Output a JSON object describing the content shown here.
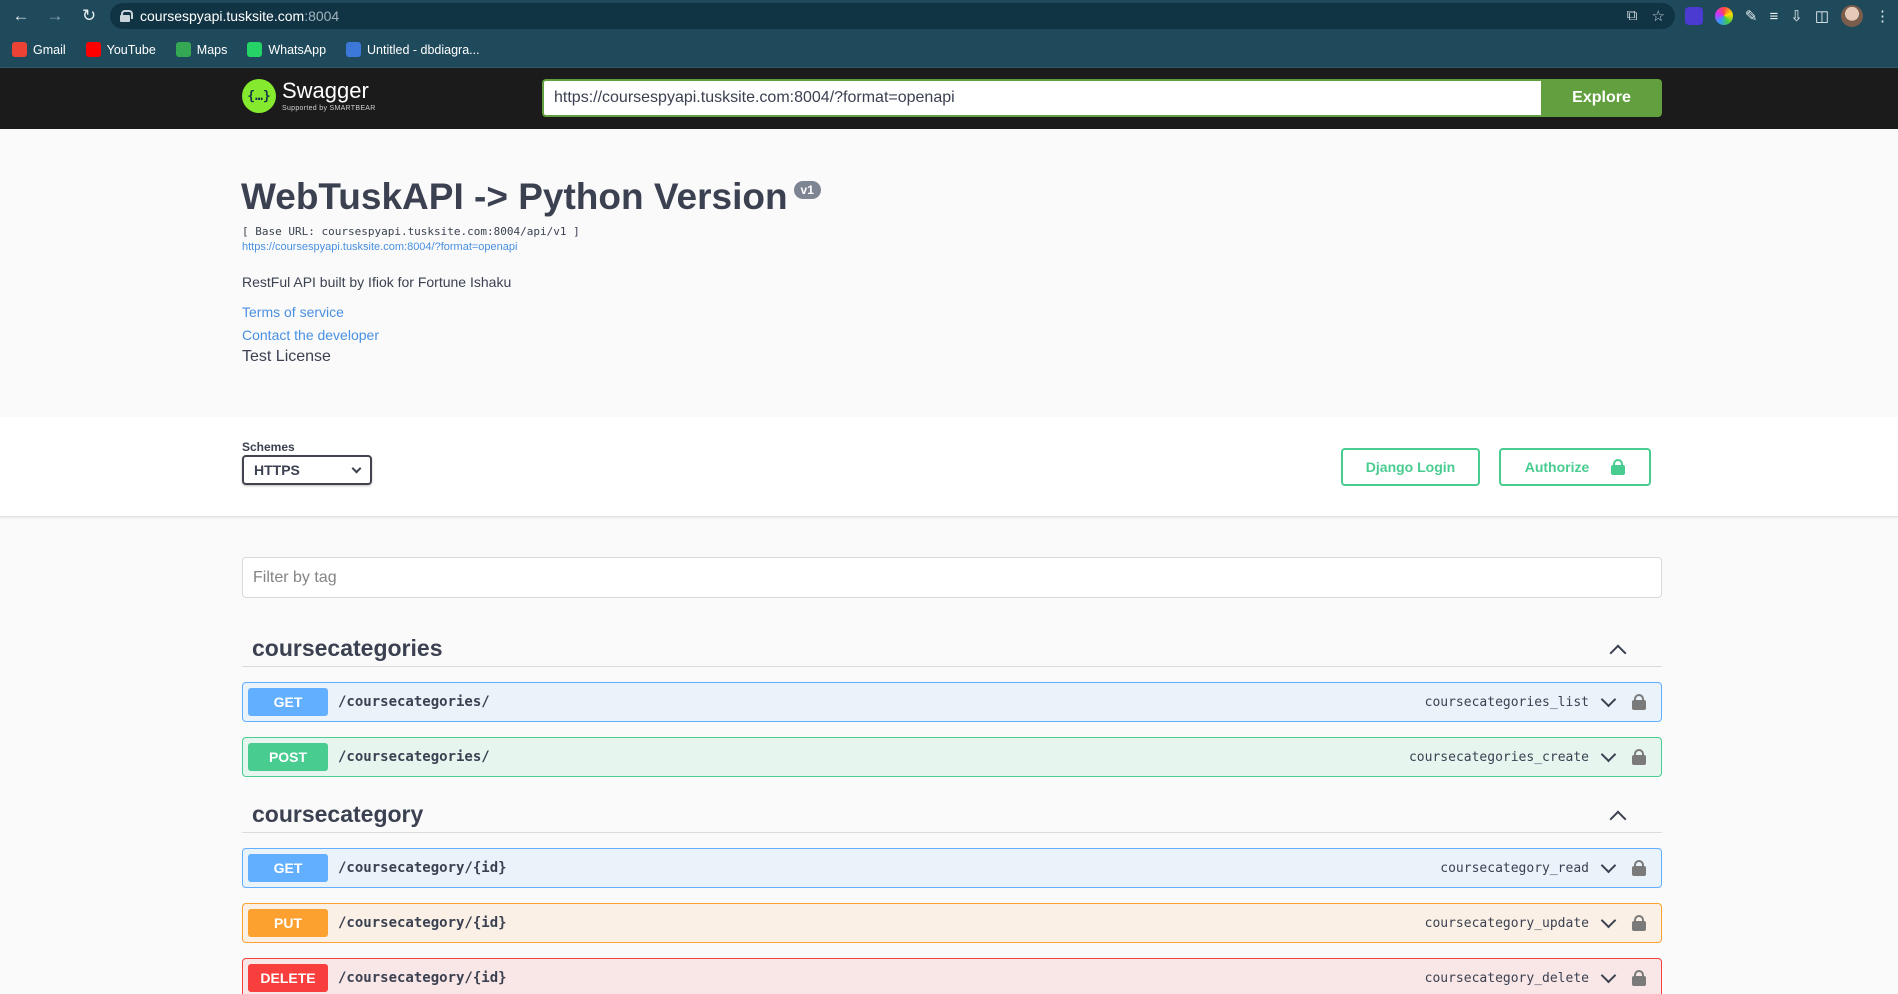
{
  "browser": {
    "url_host": "coursespyapi.tusksite.com",
    "url_port": ":8004",
    "bookmarks": [
      {
        "label": "Gmail",
        "icon": "gmail-icon",
        "color": "#ea4335"
      },
      {
        "label": "YouTube",
        "icon": "youtube-icon",
        "color": "#ff0000"
      },
      {
        "label": "Maps",
        "icon": "maps-icon",
        "color": "#34a853"
      },
      {
        "label": "WhatsApp",
        "icon": "whatsapp-icon",
        "color": "#25d366"
      },
      {
        "label": "Untitled - dbdiagra...",
        "icon": "dbdiagram-icon",
        "color": "#3c78d8"
      }
    ]
  },
  "topbar": {
    "logo_word": "Swagger",
    "logo_sub": "Supported by SMARTBEAR",
    "spec_url": "https://coursespyapi.tusksite.com:8004/?format=openapi",
    "explore_label": "Explore"
  },
  "info": {
    "title": "WebTuskAPI -> Python Version",
    "version": "v1",
    "base_url": "[ Base URL: coursespyapi.tusksite.com:8004/api/v1 ]",
    "spec_link": "https://coursespyapi.tusksite.com:8004/?format=openapi",
    "description": "RestFul API built by Ifiok for Fortune Ishaku",
    "terms": "Terms of service",
    "contact": "Contact the developer",
    "license": "Test License"
  },
  "schemes": {
    "label": "Schemes",
    "selected": "HTTPS",
    "django_login": "Django Login",
    "authorize": "Authorize"
  },
  "filter": {
    "placeholder": "Filter by tag"
  },
  "tags": [
    {
      "name": "coursecategories",
      "operations": [
        {
          "method": "GET",
          "path": "/coursecategories/",
          "operation_id": "coursecategories_list"
        },
        {
          "method": "POST",
          "path": "/coursecategories/",
          "operation_id": "coursecategories_create"
        }
      ]
    },
    {
      "name": "coursecategory",
      "operations": [
        {
          "method": "GET",
          "path": "/coursecategory/{id}",
          "operation_id": "coursecategory_read"
        },
        {
          "method": "PUT",
          "path": "/coursecategory/{id}",
          "operation_id": "coursecategory_update"
        },
        {
          "method": "DELETE",
          "path": "/coursecategory/{id}",
          "operation_id": "coursecategory_delete"
        }
      ]
    }
  ],
  "colors": {
    "get": "#61affe",
    "post": "#49cc90",
    "put": "#fca130",
    "delete": "#f93e3e",
    "accent": "#62a03f"
  }
}
